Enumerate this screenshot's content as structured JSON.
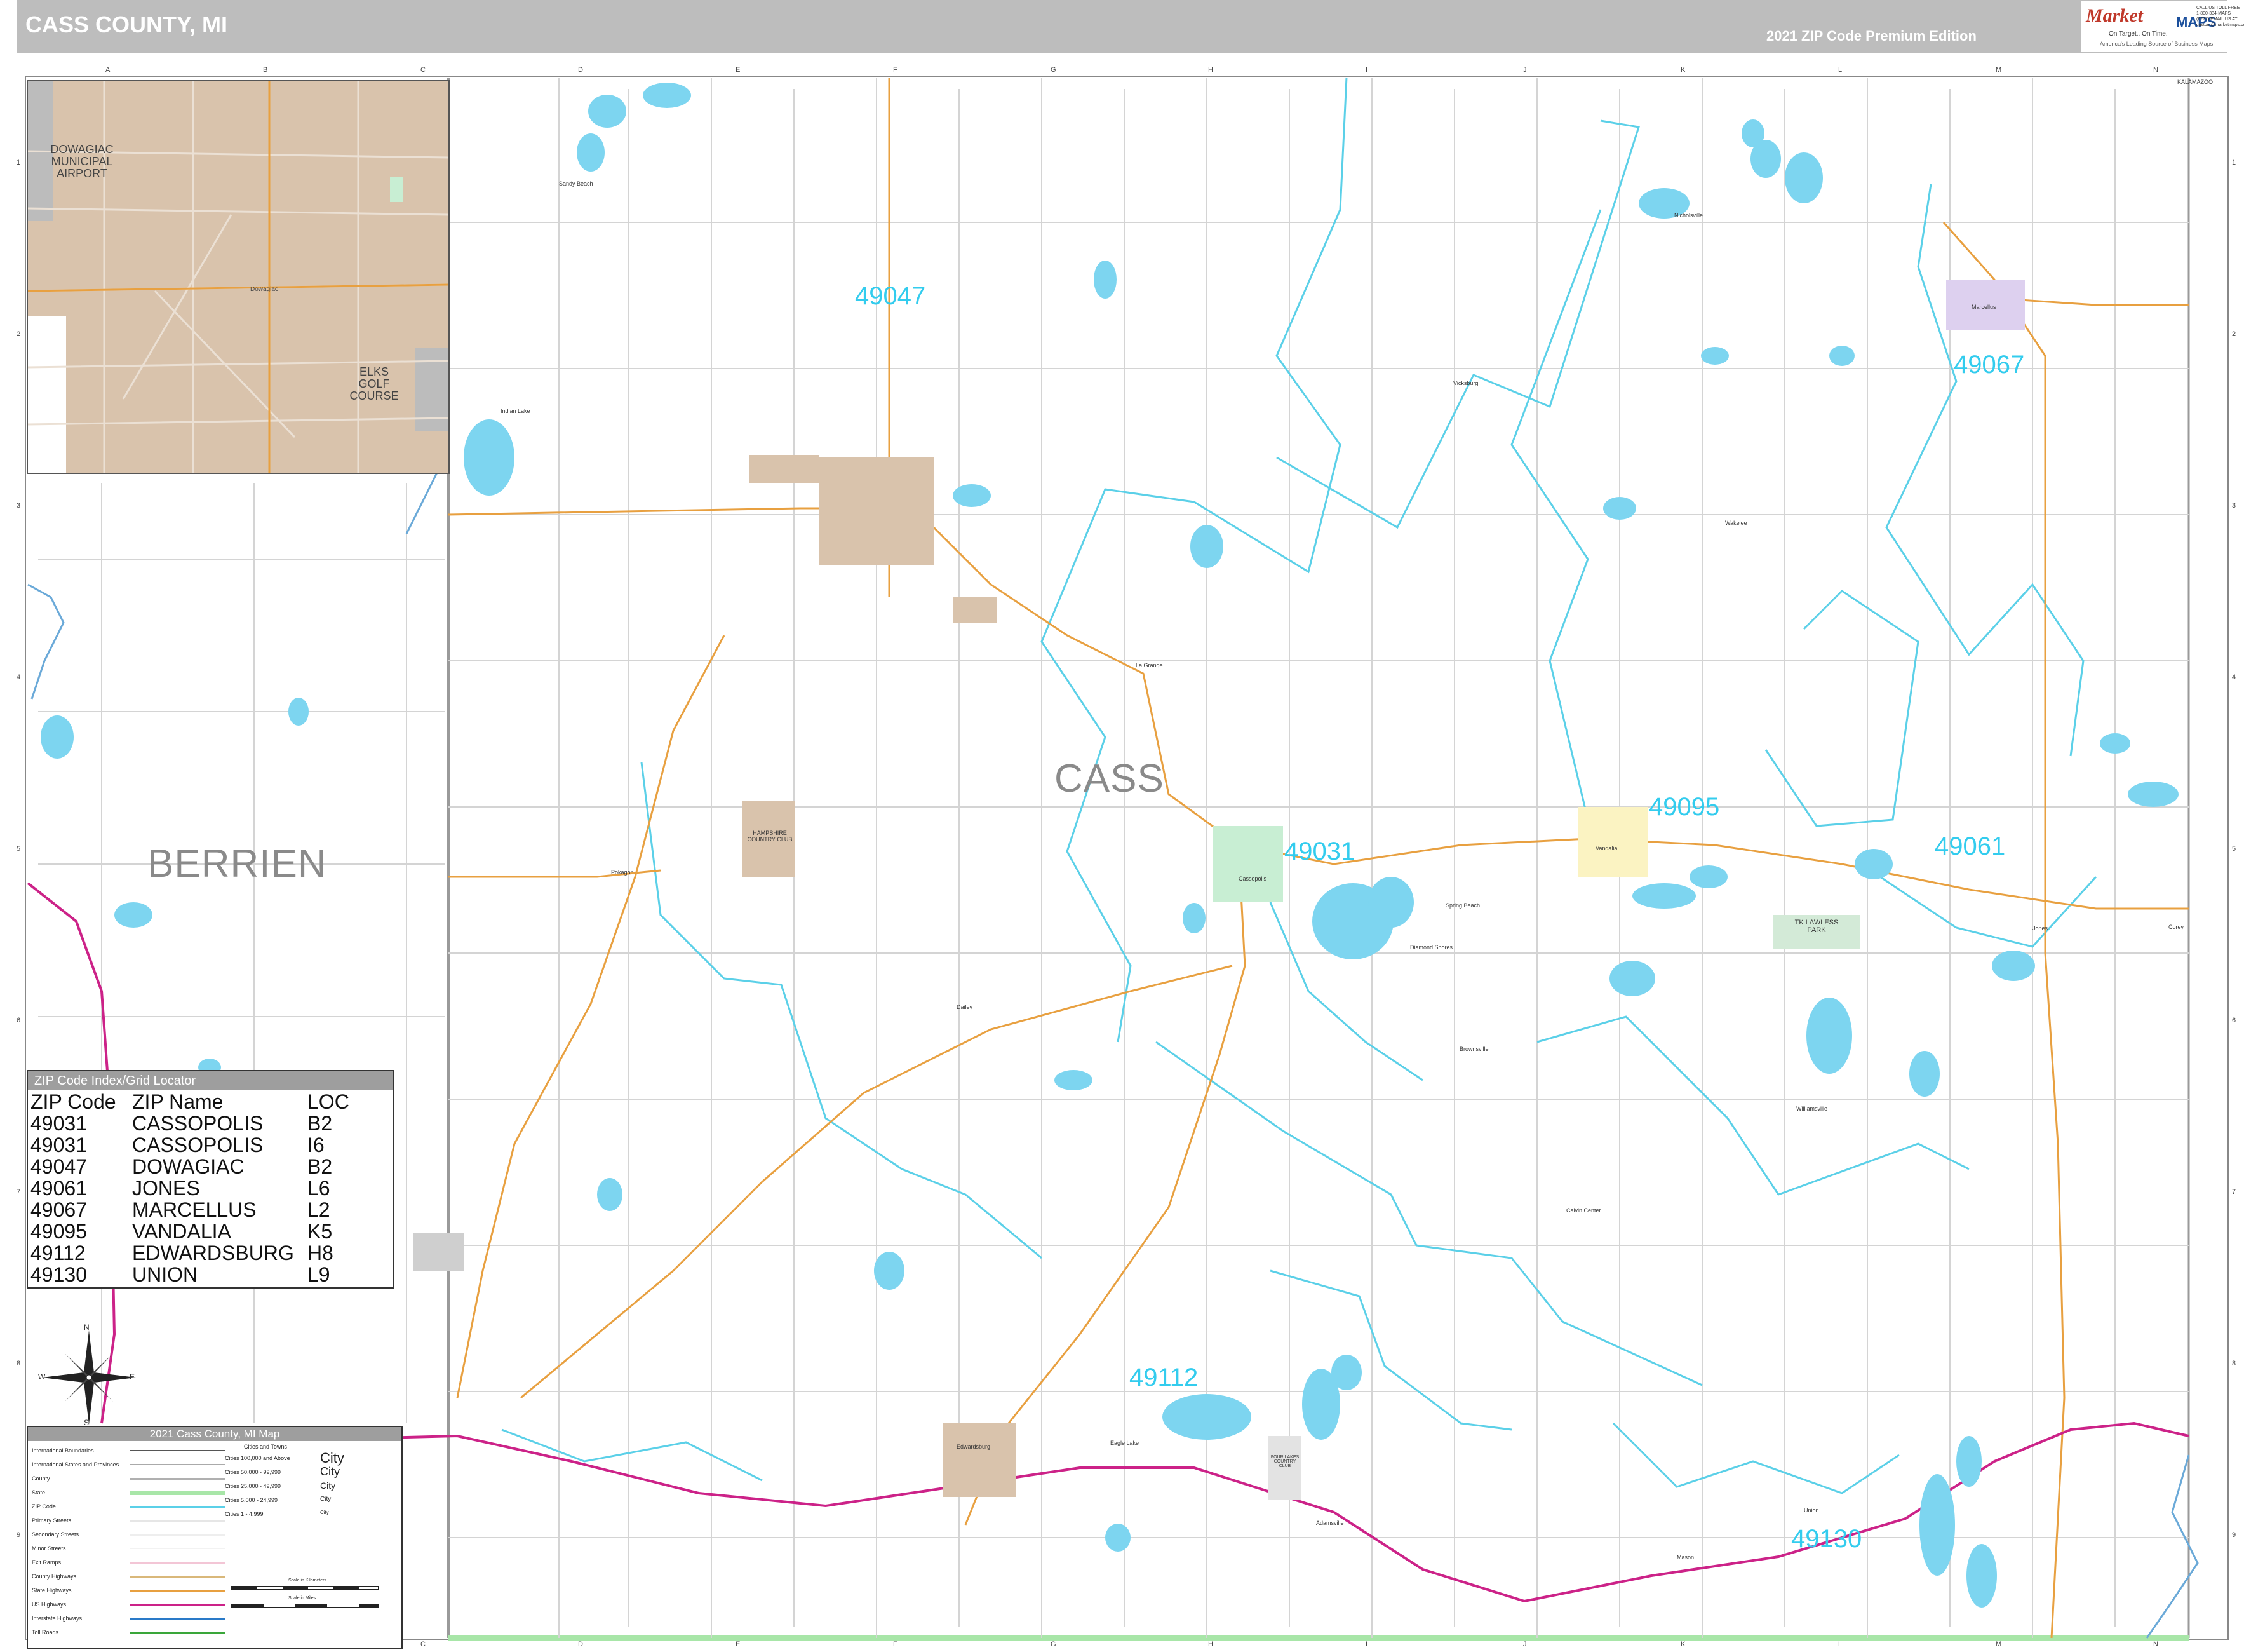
{
  "header": {
    "title": "CASS COUNTY, MI",
    "edition": "2021 ZIP Code Premium Edition"
  },
  "logo": {
    "brand_top": "Market",
    "brand_bottom": "MAPS",
    "tagline": "On Target.. On Time.",
    "subline": "America's Leading Source of Business Maps",
    "contact": "CALL US TOLL FREE 1-800-334-MAPS (6277) EMAIL US AT: custom@marketmaps.com"
  },
  "grid": {
    "letters": [
      "A",
      "B",
      "C",
      "D",
      "E",
      "F",
      "G",
      "H",
      "I",
      "J",
      "K",
      "L",
      "M",
      "N"
    ],
    "numbers": [
      "1",
      "2",
      "3",
      "4",
      "5",
      "6",
      "7",
      "8",
      "9"
    ]
  },
  "inset": {
    "labels": [
      "DOWAGIAC MUNICIPAL AIRPORT",
      "Dowagiac",
      "ELKS GOLF COURSE"
    ],
    "top_name": "DOWAGIAC"
  },
  "county_labels": {
    "cass": "CASS",
    "berrien": "BERRIEN"
  },
  "corner_labels": {
    "kalamazoo": "KALAMAZOO"
  },
  "zip_labels": [
    {
      "code": "49047"
    },
    {
      "code": "49067"
    },
    {
      "code": "49095"
    },
    {
      "code": "49031"
    },
    {
      "code": "49061"
    },
    {
      "code": "49112"
    },
    {
      "code": "49130"
    }
  ],
  "places": [
    "Sandy Beach",
    "Nicholsville",
    "Vicksburg",
    "Marcellus",
    "Wakelee",
    "La Grange",
    "Cassopolis",
    "Vandalia",
    "Jones",
    "Corey",
    "Diamond Shores",
    "Spring Beach",
    "Brownsville",
    "Williamsville",
    "Calvin Center",
    "Union",
    "Mason",
    "Edwardsburg",
    "Adamsville",
    "Pokagon",
    "Dailey",
    "Eagle Lake",
    "Indian Lake"
  ],
  "parks": {
    "hampshire": "HAMPSHIRE COUNTRY CLUB",
    "lawless": "TK LAWLESS PARK",
    "four_lakes": "FOUR LAKES COUNTRY CLUB"
  },
  "zip_index": {
    "title": "ZIP Code Index/Grid Locator",
    "headers": [
      "ZIP Code",
      "ZIP Name",
      "LOC"
    ],
    "rows": [
      [
        "49031",
        "CASSOPOLIS",
        "B2"
      ],
      [
        "49031",
        "CASSOPOLIS",
        "I6"
      ],
      [
        "49047",
        "DOWAGIAC",
        "B2"
      ],
      [
        "49061",
        "JONES",
        "L6"
      ],
      [
        "49067",
        "MARCELLUS",
        "L2"
      ],
      [
        "49095",
        "VANDALIA",
        "K5"
      ],
      [
        "49112",
        "EDWARDSBURG",
        "H8"
      ],
      [
        "49130",
        "UNION",
        "L9"
      ]
    ]
  },
  "legend": {
    "title": "2021 Cass County, MI Map",
    "left_items": [
      "International Boundaries",
      "International States and Provinces",
      "County",
      "State",
      "ZIP Code",
      "Primary Streets",
      "Secondary Streets",
      "Minor Streets",
      "Exit Ramps",
      "County Highways",
      "State Highways",
      "US Highways",
      "Interstate Highways",
      "Toll Roads"
    ],
    "city_header": "Cities and Towns",
    "city_items": [
      {
        "range": "Cities 100,000 and Above",
        "sample": "City"
      },
      {
        "range": "Cities 50,000 - 99,999",
        "sample": "City"
      },
      {
        "range": "Cities 25,000 - 49,999",
        "sample": "City"
      },
      {
        "range": "Cities 5,000 - 24,999",
        "sample": "City"
      },
      {
        "range": "Cities 1 - 4,999",
        "sample": "City"
      }
    ],
    "scale_km": "Scale in Kilometers",
    "scale_mi": "Scale in Miles",
    "colors": {
      "county": "#b0b0b0",
      "state": "#a8e6a8",
      "zip": "#5bd0e8",
      "state_highway": "#e8a040",
      "us_highway": "#cc2288",
      "interstate": "#2a7ac8",
      "toll": "#3aa63a"
    }
  },
  "compass": {
    "n": "N",
    "s": "S",
    "e": "E",
    "w": "W"
  }
}
